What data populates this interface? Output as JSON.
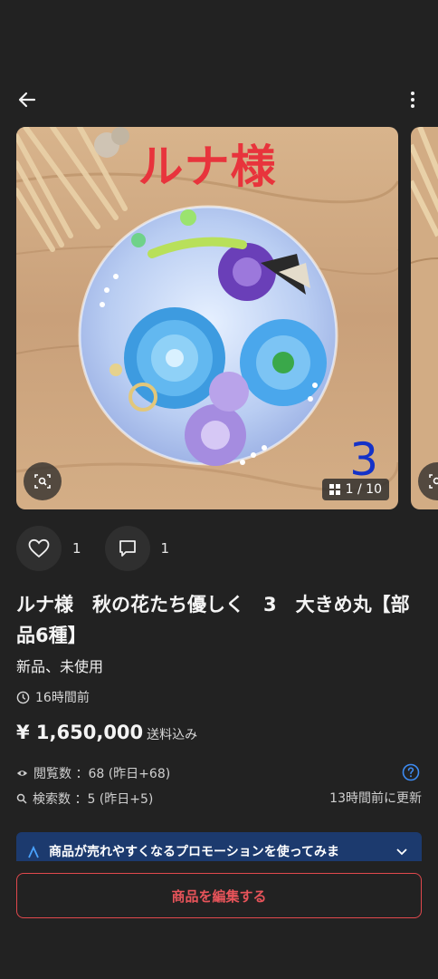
{
  "header": {
    "back_icon": "arrow-left-icon",
    "more_icon": "more-vertical-icon"
  },
  "gallery": {
    "overlay_name": "ルナ様",
    "overlay_number": "3",
    "counter": "1 / 10",
    "lens_icon": "image-search-icon",
    "counter_icon": "grid-icon"
  },
  "actions": {
    "like_count": "1",
    "comment_count": "1"
  },
  "item": {
    "title": "ルナ様　秋の花たち優しく　3　大きめ丸【部品6種】",
    "condition": "新品、未使用",
    "posted": "16時間前",
    "price": "¥ 1,650,000",
    "shipping": "送料込み"
  },
  "stats": {
    "views": "閲覧数 ：68 (昨日+68)",
    "searches": "検索数 ：5 (昨日+5)",
    "updated": "13時間前に更新"
  },
  "promo": {
    "text": "商品が売れやすくなるプロモーションを使ってみま"
  },
  "edit_button": {
    "label": "商品を編集する"
  },
  "colors": {
    "background": "#222222",
    "accent_red": "#e8545a",
    "promo_blue": "#1c3a6e",
    "help_blue": "#3d8bf2"
  }
}
